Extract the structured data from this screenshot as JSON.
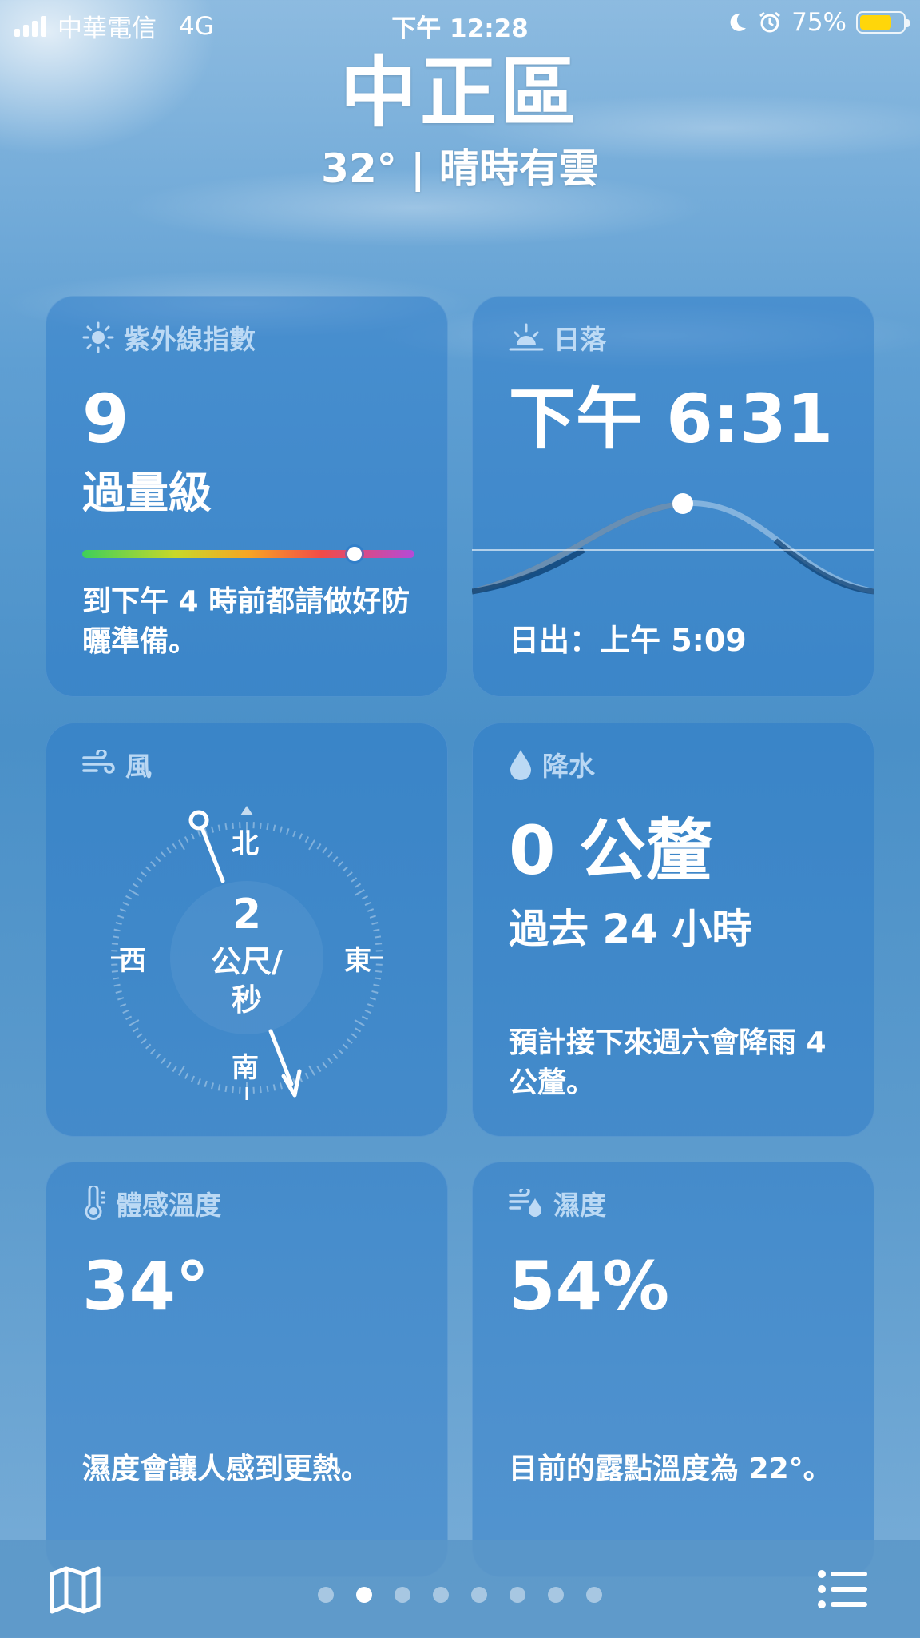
{
  "status_bar": {
    "carrier": "中華電信",
    "network": "4G",
    "time": "下午 12:28",
    "battery_percent": "75%",
    "battery_level": 0.75,
    "icons": [
      "signal-icon",
      "moon-icon",
      "alarm-icon",
      "battery-icon"
    ]
  },
  "header": {
    "city": "中正區",
    "condition_line": "32° | 晴時有雲"
  },
  "cards": {
    "uv": {
      "title": "紫外線指數",
      "icon": "sun-icon",
      "value": "9",
      "level": "過量級",
      "scale_position": 0.82,
      "description": "到下午 4 時前都請做好防曬準備。"
    },
    "sunset": {
      "title": "日落",
      "icon": "sunset-icon",
      "time": "下午 6:31",
      "sunrise": "日出：上午 5:09"
    },
    "wind": {
      "title": "風",
      "icon": "wind-icon",
      "speed": "2",
      "unit_line1": "公尺/",
      "unit_line2": "秒",
      "north": "北",
      "south": "南",
      "east": "東",
      "west": "西"
    },
    "precip": {
      "title": "降水",
      "icon": "raindrop-icon",
      "amount": "0 公釐",
      "period": "過去 24 小時",
      "description": "預計接下來週六會降雨 4 公釐。"
    },
    "feels_like": {
      "title": "體感溫度",
      "icon": "thermometer-icon",
      "value": "34°",
      "description": "濕度會讓人感到更熱。"
    },
    "humidity": {
      "title": "濕度",
      "icon": "humidity-icon",
      "value": "54%",
      "description": "目前的露點溫度為 22°。"
    }
  },
  "tab_bar": {
    "map_icon": "map-icon",
    "list_icon": "list-icon",
    "page_count": 8,
    "active_page": 2
  },
  "colors": {
    "uv_indicator_gradient": [
      "#3ecf5a",
      "#c8d82a",
      "#f7a524",
      "#f24b47",
      "#b54ad8"
    ],
    "battery_fill": "#ffd60a"
  }
}
